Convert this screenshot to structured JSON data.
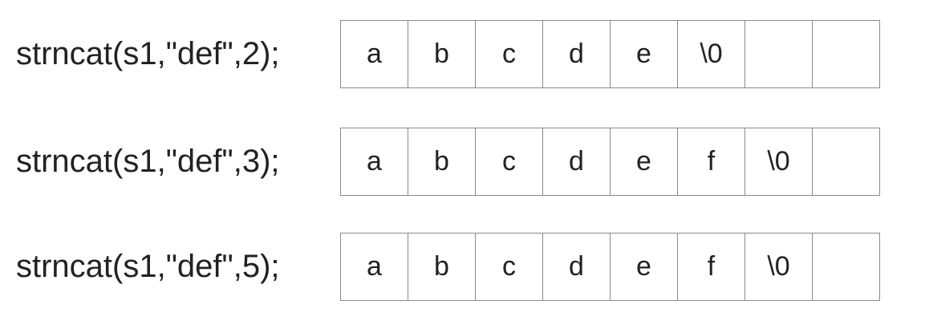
{
  "rows": [
    {
      "call": "strncat(s1,\"def\",2);",
      "cells": [
        "a",
        "b",
        "c",
        "d",
        "e",
        "\\0",
        "",
        ""
      ]
    },
    {
      "call": "strncat(s1,\"def\",3);",
      "cells": [
        "a",
        "b",
        "c",
        "d",
        "e",
        "f",
        "\\0",
        ""
      ]
    },
    {
      "call": "strncat(s1,\"def\",5);",
      "cells": [
        "a",
        "b",
        "c",
        "d",
        "e",
        "f",
        "\\0",
        ""
      ]
    }
  ]
}
